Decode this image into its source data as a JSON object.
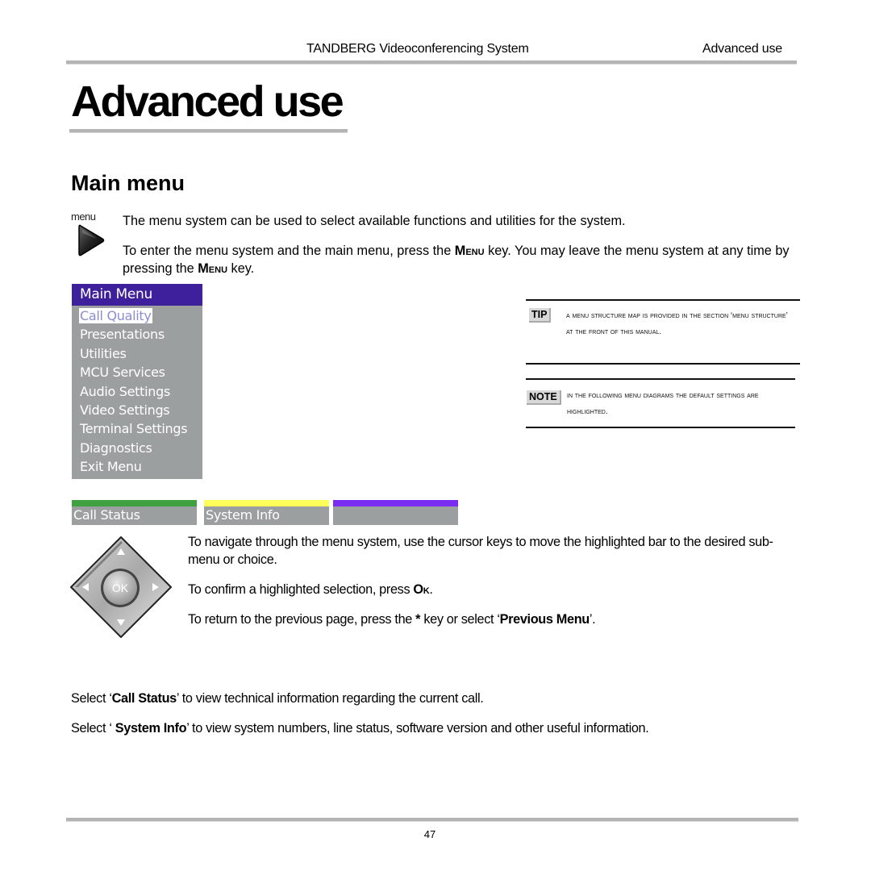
{
  "header": {
    "doc_title": "TANDBERG Videoconferencing System",
    "section": "Advanced use"
  },
  "page_title": "Advanced use",
  "section_title": "Main menu",
  "menu_key": {
    "label": "menu",
    "icon": "menu-key-icon"
  },
  "intro": {
    "p1": "The menu system can be used to select available functions and utilities for the system.",
    "p2_a": "To enter the menu system and the main menu, press the ",
    "p2_key1": "Menu",
    "p2_b": " key. You may leave the menu system at any time by pressing the ",
    "p2_key2": "Menu",
    "p2_c": " key."
  },
  "osd_menu": {
    "title": "Main Menu",
    "selected": "Call Quality",
    "items": [
      "Call Quality",
      "Presentations",
      "Utilities",
      "MCU Services",
      "Audio Settings",
      "Video Settings",
      "Terminal Settings",
      "Diagnostics",
      "Exit Menu"
    ],
    "colors": {
      "header": "#3e1f9c",
      "body": "#9c9fa0"
    }
  },
  "softkeys": [
    {
      "label": "Call Status",
      "color": "#3fa142"
    },
    {
      "label": "System Info",
      "color": "#ffff5a"
    },
    {
      "label": "",
      "color": "#7a2cf0"
    }
  ],
  "tip": {
    "badge": "TIP",
    "text": "A menu structure map is provided in the section ‘Menu structure’ at the front of this manual."
  },
  "note": {
    "badge": "NOTE",
    "text": "In the following menu diagrams the default settings are highlighted."
  },
  "dpad": {
    "center_label": "OK",
    "icon": "navigation-pad-icon"
  },
  "nav": {
    "p3": "To navigate through the menu system, use the cursor keys to move the highlighted bar to the desired sub-menu or choice.",
    "p4_a": "To confirm a highlighted selection, press ",
    "p4_key": "Ok",
    "p4_b": ".",
    "p5_a": "To return to the previous page, press the ",
    "p5_star": "*",
    "p5_b": " key or select ‘",
    "p5_bold": "Previous Menu",
    "p5_c": "’."
  },
  "select": {
    "p6_a": "Select ‘",
    "p6_bold": "Call Status",
    "p6_b": "’ to view technical information regarding the current call.",
    "p7_a": "Select ‘ ",
    "p7_bold": "System Info",
    "p7_b": "’ to view system numbers, line status, software version and other useful information."
  },
  "page_number": "47"
}
